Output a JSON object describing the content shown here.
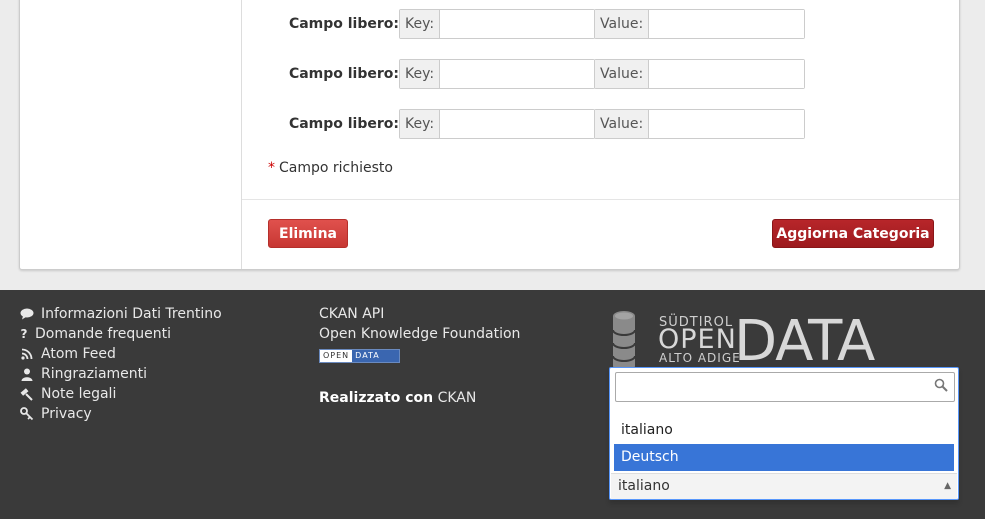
{
  "form": {
    "rows": [
      {
        "label": "Campo libero:",
        "key_addon": "Key:",
        "value_addon": "Value:"
      },
      {
        "label": "Campo libero:",
        "key_addon": "Key:",
        "value_addon": "Value:"
      },
      {
        "label": "Campo libero:",
        "key_addon": "Key:",
        "value_addon": "Value:"
      }
    ],
    "required_star": "*",
    "required_text": "Campo richiesto",
    "delete_label": "Elimina",
    "update_label": "Aggiorna Categoria"
  },
  "footer": {
    "links": [
      {
        "label": "Informazioni Dati Trentino",
        "icon": "comment-icon"
      },
      {
        "label": "Domande frequenti",
        "icon": "question-icon"
      },
      {
        "label": "Atom Feed",
        "icon": "rss-icon"
      },
      {
        "label": "Ringraziamenti",
        "icon": "user-icon"
      },
      {
        "label": "Note legali",
        "icon": "legal-icon"
      },
      {
        "label": "Privacy",
        "icon": "key-icon"
      }
    ],
    "ckan_api": "CKAN API",
    "okf": "Open Knowledge Foundation",
    "badge_left": "OPEN",
    "badge_right": "DATA",
    "made_with_prefix": "Realizzato con",
    "made_with_name": "CKAN",
    "logo": {
      "line1": "SÜDTIROL",
      "line2": "OPEN",
      "line3": "ALTO ADIGE",
      "line4": "DATA"
    }
  },
  "language_select": {
    "search_value": "",
    "options": [
      "italiano",
      "Deutsch"
    ],
    "highlighted": "Deutsch",
    "selected": "italiano"
  },
  "colors": {
    "primary_red": "#9d1a1e",
    "delete_red": "#d9443f",
    "highlight": "#3875d7",
    "footer_bg": "#3a3a3a"
  }
}
